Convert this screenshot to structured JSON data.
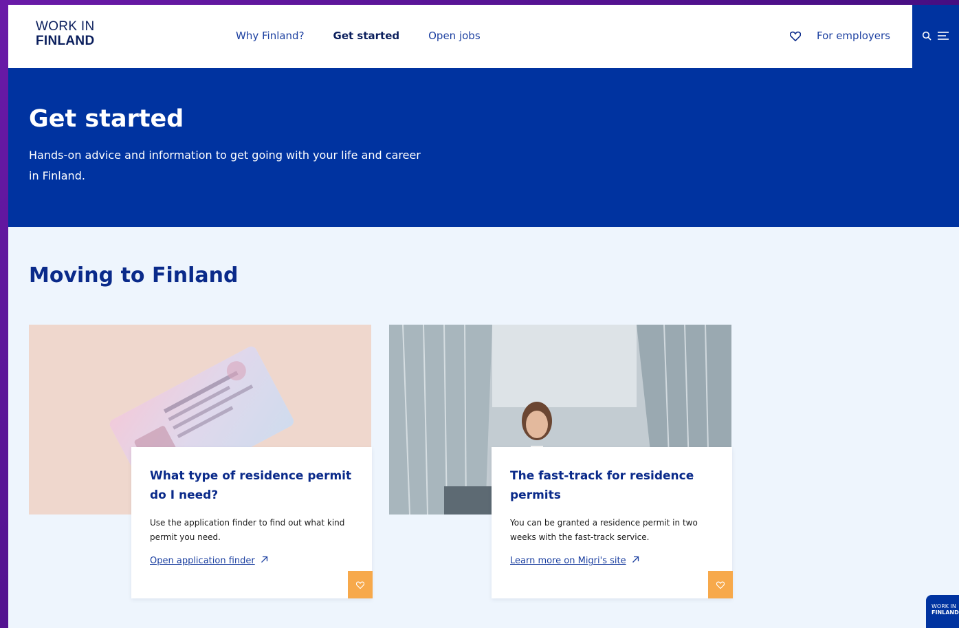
{
  "header": {
    "logo_line1": "WORK IN",
    "logo_line2": "FINLAND",
    "nav": [
      {
        "label": "Why Finland?"
      },
      {
        "label": "Get started",
        "active": true
      },
      {
        "label": "Open jobs"
      }
    ],
    "favorites_icon": "heart-outline-icon",
    "employers_label": "For employers",
    "search_icon": "search-icon",
    "menu_icon": "menu-icon"
  },
  "hero": {
    "title": "Get started",
    "description": "Hands-on advice and information to get going with your life and career in Finland."
  },
  "section": {
    "title": "Moving to Finland",
    "cards": [
      {
        "title": "What type of residence permit do I need?",
        "text": "Use the application finder to find out what kind permit you need.",
        "link": "Open application finder",
        "link_icon": "arrow-up-right-icon",
        "fav_icon": "heart-icon"
      },
      {
        "title": "The fast-track for residence permits",
        "text": "You can be granted a residence permit in two weeks with the fast-track service.",
        "link": "Learn more on Migri's site",
        "link_icon": "arrow-up-right-icon",
        "fav_icon": "heart-icon"
      }
    ]
  },
  "floating_badge": {
    "line1": "WORK IN",
    "line2": "FINLAND"
  },
  "colors": {
    "primary": "#0033a0",
    "heading": "#0a2a8a",
    "accent": "#f7a94b",
    "background": "#eef5fd"
  }
}
